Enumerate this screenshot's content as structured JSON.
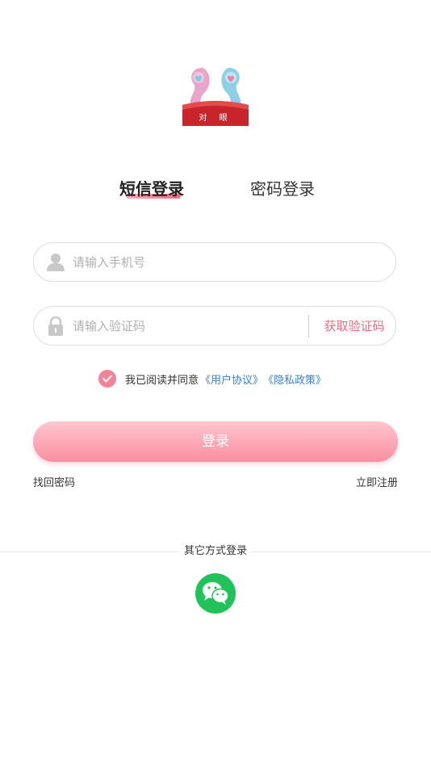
{
  "logo": {
    "text": "对 眼",
    "icon": "couple-logo-icon"
  },
  "tabs": {
    "sms": "短信登录",
    "password": "密码登录"
  },
  "phone_field": {
    "placeholder": "请输入手机号",
    "icon": "user-icon"
  },
  "code_field": {
    "placeholder": "请输入验证码",
    "icon": "lock-icon",
    "get_code": "获取验证码"
  },
  "agreement": {
    "prefix": "我已阅读并同意",
    "user_agreement": "《用户协议》",
    "privacy_policy": "《隐私政策》",
    "checked": true
  },
  "login_button": "登录",
  "links": {
    "forgot": "找回密码",
    "register": "立即注册"
  },
  "other_login": {
    "label": "其它方式登录",
    "icon": "wechat-icon"
  },
  "colors": {
    "accent": "#f06b80",
    "link": "#3a7fd5",
    "wechat": "#21c25a"
  }
}
